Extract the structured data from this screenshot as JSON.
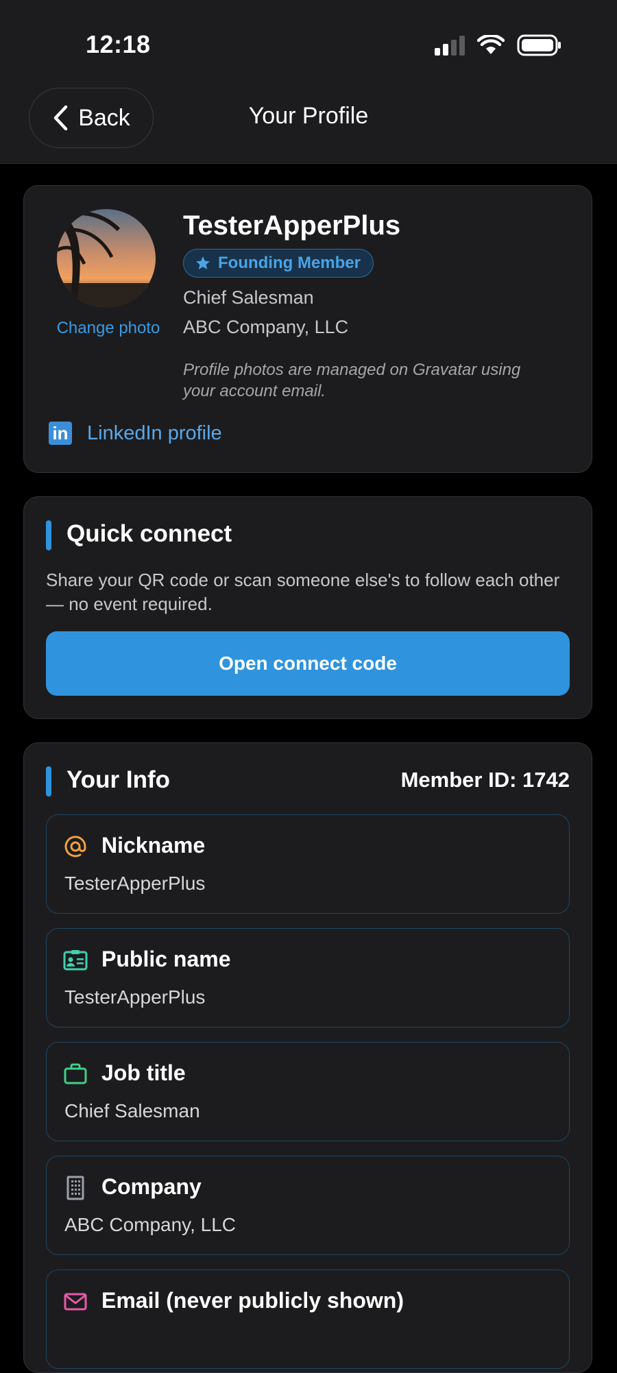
{
  "status_bar": {
    "time": "12:18"
  },
  "nav": {
    "back_label": "Back",
    "title": "Your Profile"
  },
  "profile": {
    "username": "TesterApperPlus",
    "badge": "Founding Member",
    "job_title": "Chief Salesman",
    "company": "ABC Company, LLC",
    "change_photo": "Change photo",
    "gravatar_note": "Profile photos are managed on Gravatar using your account email.",
    "linkedin_label": "LinkedIn profile"
  },
  "quick_connect": {
    "title": "Quick connect",
    "description": "Share your QR code or scan someone else's to follow each other — no event required.",
    "button_label": "Open connect code"
  },
  "your_info": {
    "title": "Your Info",
    "member_id": "Member ID: 1742",
    "fields": [
      {
        "label": "Nickname",
        "value": "TesterApperPlus",
        "icon": "at-icon"
      },
      {
        "label": "Public name",
        "value": "TesterApperPlus",
        "icon": "id-card-icon"
      },
      {
        "label": "Job title",
        "value": "Chief Salesman",
        "icon": "briefcase-icon"
      },
      {
        "label": "Company",
        "value": "ABC Company, LLC",
        "icon": "building-icon"
      },
      {
        "label": "Email (never publicly shown)",
        "value": "",
        "icon": "mail-icon"
      }
    ]
  },
  "colors": {
    "accent": "#2f93dd",
    "nickname_icon": "#f0a040",
    "public_name_icon": "#3fd0b0",
    "job_icon": "#3fd08a",
    "company_icon": "#9aa0aa",
    "email_icon": "#e85aa8"
  }
}
